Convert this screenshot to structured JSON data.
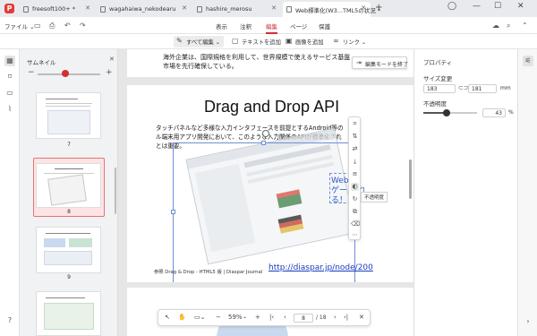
{
  "tabs": [
    {
      "label": "freesoft100+ *"
    },
    {
      "label": "wagahaiwa_nekodearu"
    },
    {
      "label": "hashire_merosu"
    },
    {
      "label": "Web標準化(W3...TML5の状況 *"
    }
  ],
  "menu": {
    "file": "ファイル",
    "items": [
      "表示",
      "注釈",
      "編集",
      "ページ",
      "保護"
    ],
    "active": "編集"
  },
  "subtoolbar": {
    "edit_all": "すべて編集",
    "add_text": "テキストを追加",
    "add_image": "画像を追加",
    "link": "リンク"
  },
  "thumbnails": {
    "title": "サムネイル",
    "pages": [
      "7",
      "8",
      "9"
    ]
  },
  "document": {
    "top_text_line1": "海外企業は、国際規格を利用して、世界規模で使えるサービス基盤",
    "top_text_line2": "市場を先行確保している。",
    "slide_title": "Drag and Drop API",
    "body_line1": "タッチパネルなど多様な入力インタフェースを前提とするAndroid等の",
    "body_line2": "ル端末用アプリ開発において、このような入力関係のAPIが標準化され",
    "body_line3": "とは重要。",
    "side_text_line1": "Webで",
    "side_text_line2": "ゲー 作れ",
    "side_text_line3": "る！",
    "caption": "参照 Drag & Drop - HTML5 版 | Diaspar Journal",
    "link": "http://diaspar.jp/node/200",
    "tooltip": "不透明度",
    "exit_edit_mode": "編集モードを終了"
  },
  "properties": {
    "title": "プロパティ",
    "size_label": "サイズ変更",
    "width": "183",
    "height": "181",
    "unit": "mm",
    "opacity_label": "不透明度",
    "opacity_value": "43",
    "opacity_unit": "%",
    "opacity_fraction": 0.43
  },
  "zoombar": {
    "zoom": "59%",
    "current_page": "8",
    "total_pages": "/ 18"
  }
}
